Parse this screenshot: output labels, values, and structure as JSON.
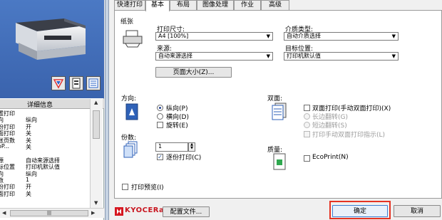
{
  "tabs": [
    "快速打印",
    "基本",
    "布局",
    "图像处理",
    "作业",
    "高级"
  ],
  "active_tab": "基本",
  "left_panel": {
    "info_header": "详细信息",
    "info_rows": [
      [
        "置打印",
        ""
      ],
      [
        "向",
        "纵向"
      ],
      [
        "份打印",
        "开"
      ],
      [
        "面打印",
        "关"
      ],
      [
        "张页数",
        "关"
      ],
      [
        "oP...",
        "关"
      ],
      [
        "",
        ""
      ],
      [
        "源",
        "自动来源选择"
      ],
      [
        "标位置",
        "打印机默认值"
      ],
      [
        "向",
        "纵向"
      ],
      [
        "数",
        "1"
      ],
      [
        "份打印",
        "开"
      ],
      [
        "面打印",
        "关"
      ]
    ],
    "hscroll_mark": "|||",
    "colors": {
      "preview_bg": "#3f6cb8"
    }
  },
  "paper": {
    "group_label": "纸张",
    "print_size_label": "打印尺寸:",
    "print_size_value": "A4   [100%]",
    "source_label": "来源:",
    "source_value": "自动来源选择",
    "page_size_button": "页面大小(Z)...",
    "media_type_label": "介质类型:",
    "media_type_value": "自动介质选择",
    "destination_label": "目标位置:",
    "destination_value": "打印机默认值"
  },
  "orientation": {
    "label": "方向:",
    "portrait": "纵向(P)",
    "landscape": "横向(D)",
    "rotate": "旋转(E)",
    "selected": "portrait"
  },
  "copies": {
    "label": "份数:",
    "value": "1",
    "collate": "逐份打印(C)",
    "collate_checked": true
  },
  "duplex": {
    "label": "双面:",
    "manual_duplex": "双面打印(手动双面打印)(X)",
    "long_edge": "长边翻转(G)",
    "short_edge": "短边翻转(S)",
    "manual_hint": "打印手动双面打印指示(L)"
  },
  "quality": {
    "label": "质量:",
    "ecoprint": "EcoPrint(N)"
  },
  "print_preview": "打印预览(I)",
  "footer": {
    "brand": "KYOCERa",
    "profile_button": "配置文件...",
    "ok_button": "确定",
    "cancel_button": "取消",
    "highlight_color": "#e53323"
  }
}
